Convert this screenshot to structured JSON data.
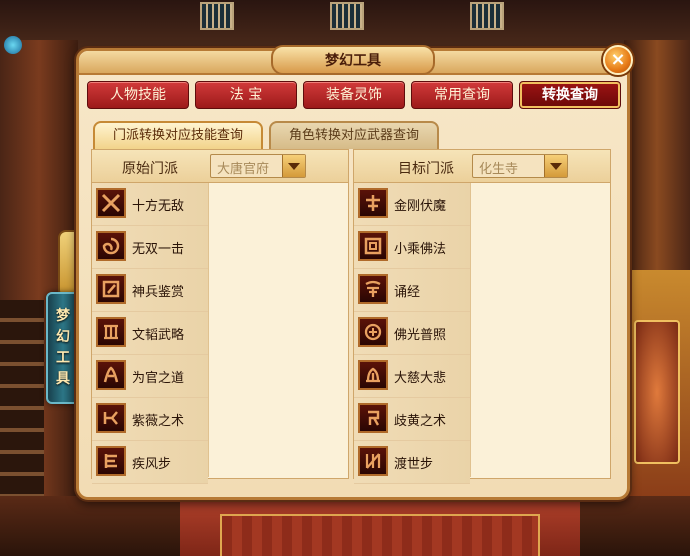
{
  "window": {
    "title": "梦幻工具",
    "close_symbol": "×"
  },
  "side_tab": {
    "chars": [
      "梦",
      "幻",
      "工",
      "具"
    ]
  },
  "top_buttons": [
    {
      "label": "人物技能",
      "active": false
    },
    {
      "label": "法 宝",
      "active": false
    },
    {
      "label": "装备灵饰",
      "active": false
    },
    {
      "label": "常用查询",
      "active": false
    },
    {
      "label": "转换查询",
      "active": true
    }
  ],
  "sub_tabs": [
    {
      "label": "门派转换对应技能查询",
      "active": true
    },
    {
      "label": "角色转换对应武器查询",
      "active": false
    }
  ],
  "left": {
    "header_label": "原始门派",
    "dropdown_value": "大唐官府",
    "skills": [
      {
        "name": "十方无敌",
        "icon": "cross-blades-icon"
      },
      {
        "name": "无双一击",
        "icon": "spiral-icon"
      },
      {
        "name": "神兵鉴赏",
        "icon": "blade-frame-icon"
      },
      {
        "name": "文韬武略",
        "icon": "scroll-icon"
      },
      {
        "name": "为官之道",
        "icon": "claw-icon"
      },
      {
        "name": "紫薇之术",
        "icon": "stance-icon"
      },
      {
        "name": "疾风步",
        "icon": "dash-icon"
      }
    ]
  },
  "right": {
    "header_label": "目标门派",
    "dropdown_value": "化生寺",
    "skills": [
      {
        "name": "金刚伏魔",
        "icon": "vajra-icon"
      },
      {
        "name": "小乘佛法",
        "icon": "dharma-icon"
      },
      {
        "name": "诵经",
        "icon": "sutra-icon"
      },
      {
        "name": "佛光普照",
        "icon": "halo-icon"
      },
      {
        "name": "大慈大悲",
        "icon": "lotus-icon"
      },
      {
        "name": "歧黄之术",
        "icon": "herb-icon"
      },
      {
        "name": "渡世步",
        "icon": "stride-icon"
      }
    ]
  },
  "colors": {
    "accent_red": "#b42020",
    "panel_bg": "#f7e7c8",
    "border_gold": "#b77a35"
  }
}
